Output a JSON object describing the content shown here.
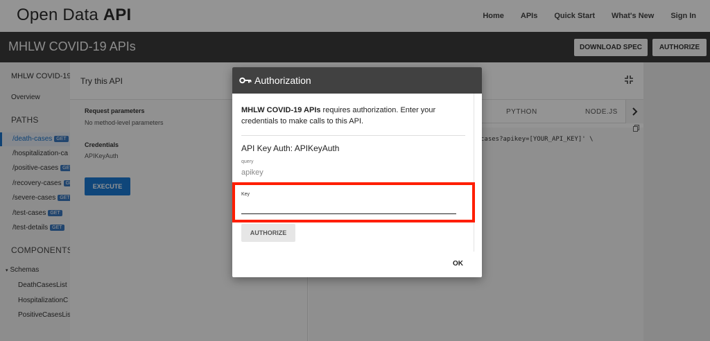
{
  "header": {
    "brand_prefix": "Open Data ",
    "brand_strong": "API",
    "nav": [
      "Home",
      "APIs",
      "Quick Start",
      "What's New",
      "Sign In"
    ]
  },
  "titlebar": {
    "title": "MHLW COVID-19 APIs",
    "download_label": "DOWNLOAD SPEC",
    "authorize_label": "AUTHORIZE"
  },
  "sidebar": {
    "api_name": "MHLW COVID-19",
    "overview": "Overview",
    "paths_heading": "PATHS",
    "paths": [
      {
        "label": "/death-cases",
        "badge": "GET"
      },
      {
        "label": "/hospitalization-ca",
        "badge": ""
      },
      {
        "label": "/positive-cases",
        "badge": "GET"
      },
      {
        "label": "/recovery-cases",
        "badge": "GET"
      },
      {
        "label": "/severe-cases",
        "badge": "GET"
      },
      {
        "label": "/test-cases",
        "badge": "GET"
      },
      {
        "label": "/test-details",
        "badge": "GET"
      }
    ],
    "components_heading": "COMPONENTS",
    "schemas_label": "Schemas",
    "schemas": [
      "DeathCasesList",
      "HospitalizationC",
      "PositiveCasesLis"
    ]
  },
  "panel": {
    "title": "Try this API",
    "request_params_label": "Request parameters",
    "request_params_value": "No method-level parameters",
    "credentials_label": "Credentials",
    "credentials_value": "APIKeyAuth",
    "execute_label": "EXECUTE",
    "code_tabs": [
      "PYTHON",
      "NODE.JS"
    ],
    "code_line": "cases?apikey=[YOUR_API_KEY]' \\"
  },
  "modal": {
    "title": "Authorization",
    "body_strong": "MHLW COVID-19 APIs",
    "body_rest": " requires authorization. Enter your credentials to make calls to this API.",
    "auth_title": "API Key Auth: APIKeyAuth",
    "query_label": "query",
    "apikey_label": "apikey",
    "key_label": "Key",
    "key_value": "",
    "authorize_label": "AUTHORIZE",
    "ok_label": "OK"
  },
  "colors": {
    "highlight": "#ff1e00",
    "accent": "#1b79d3",
    "titlebar": "#3b3b3b"
  }
}
